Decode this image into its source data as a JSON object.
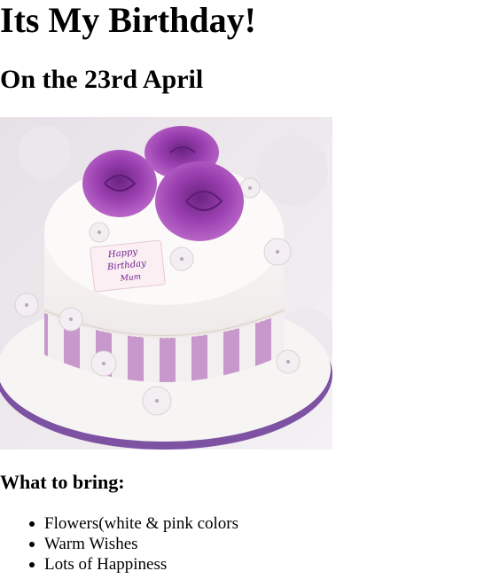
{
  "page": {
    "title": "Its My Birthday!",
    "subtitle": "On the 23rd April"
  },
  "photo": {
    "alt": "Birthday cake",
    "message_lines": [
      "Happy",
      "Birthday",
      "Mum"
    ],
    "colors": {
      "background": "#efebef",
      "icing": "#f8f6f4",
      "stripe": "#c59bc9",
      "roses": "#9b3fb0",
      "ribbon": "#8a5aa8"
    }
  },
  "bring": {
    "heading": "What to bring:",
    "items": [
      "Flowers(white & pink colors",
      "Warm Wishes",
      "Lots of Happiness"
    ]
  }
}
